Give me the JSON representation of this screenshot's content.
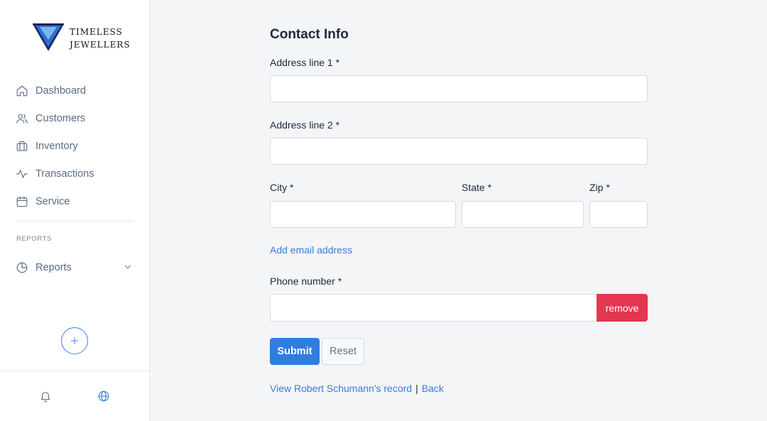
{
  "brand": {
    "name_line1": "TIMELESS",
    "name_line2": "JEWELLERS",
    "logo_icon": "diamond-logo"
  },
  "sidebar": {
    "items": [
      {
        "label": "Dashboard",
        "icon": "home-icon"
      },
      {
        "label": "Customers",
        "icon": "users-icon"
      },
      {
        "label": "Inventory",
        "icon": "briefcase-icon"
      },
      {
        "label": "Transactions",
        "icon": "activity-icon"
      },
      {
        "label": "Service",
        "icon": "calendar-icon"
      }
    ],
    "section_title": "REPORTS",
    "reports": {
      "label": "Reports",
      "icon": "pie-chart-icon",
      "chevron": "chevron-down-icon"
    },
    "add_icon": "plus-icon",
    "footer_icons": [
      "bell-icon",
      "globe-icon"
    ]
  },
  "form": {
    "title": "Contact Info",
    "address1": {
      "label": "Address line 1 *",
      "value": "",
      "placeholder": ""
    },
    "address2": {
      "label": "Address line 2 *",
      "value": "",
      "placeholder": ""
    },
    "city": {
      "label": "City *",
      "value": "",
      "placeholder": ""
    },
    "state": {
      "label": "State *",
      "value": "",
      "placeholder": ""
    },
    "zip": {
      "label": "Zip *",
      "value": "",
      "placeholder": ""
    },
    "add_email_link": "Add email address",
    "phone": {
      "label": "Phone number *",
      "value": "",
      "placeholder": ""
    },
    "remove_label": "remove",
    "submit_label": "Submit",
    "reset_label": "Reset",
    "view_record_link": "View Robert Schumann's record",
    "separator": "|",
    "back_link": "Back"
  },
  "colors": {
    "accent": "#2f7ddf",
    "link": "#3b7dd8",
    "danger": "#e5364f",
    "sidebar_text": "#5b6b82",
    "background": "#f4f5f7"
  }
}
